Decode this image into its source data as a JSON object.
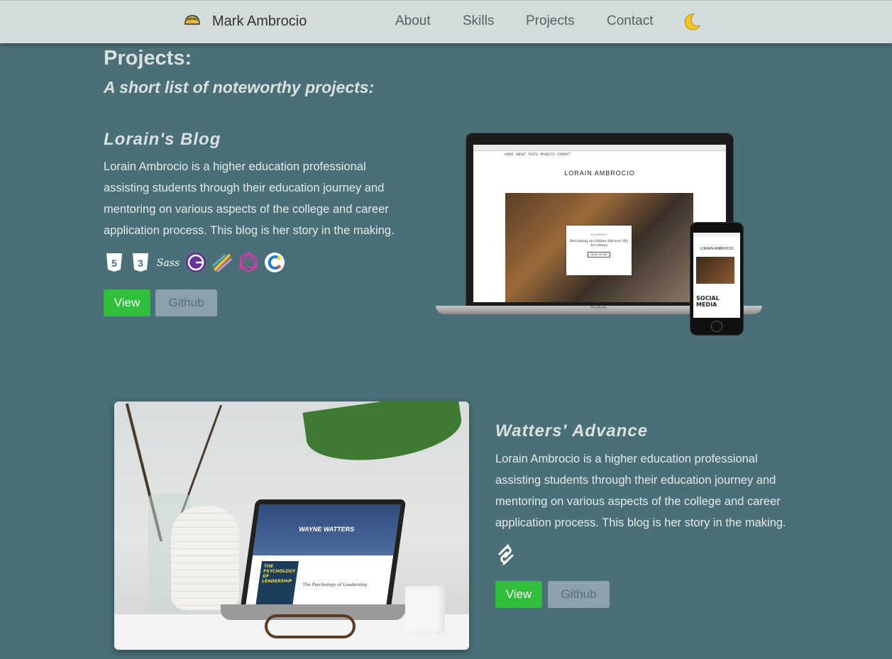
{
  "nav": {
    "brand": "Mark Ambrocio",
    "links": [
      "About",
      "Skills",
      "Projects",
      "Contact"
    ]
  },
  "page": {
    "title": "Projects:",
    "subtitle": "A short list of noteworthy projects:"
  },
  "projects": [
    {
      "title": "Lorain's Blog",
      "description": "Lorain Ambrocio is a higher education professional assisting students through their education journey and mentoring on various aspects of the college and career application process. This blog is her story in the making.",
      "tech_icons": [
        "html5-icon",
        "css3-icon",
        "sass-icon",
        "gatsby-icon",
        "prettier-icon",
        "graphql-icon",
        "contentful-icon"
      ],
      "view_label": "View",
      "github_label": "Github",
      "mockup": {
        "site_title": "LORAIN AMBROCIO",
        "nav_items": "HOME · ABOUT · POSTS · PROJECTS · CONTACT",
        "card_tag": "PLANNING",
        "card_title": "Becoming an Online Advisor (By Accident)",
        "card_button": "READ MORE",
        "laptop_label": "MacBook",
        "phone_title": "LORAIN AMBROCIO",
        "phone_banner": "SOCIAL MEDIA"
      }
    },
    {
      "title": "Watters' Advance",
      "description": "Lorain Ambrocio is a higher education professional assisting students through their education journey and mentoring on various aspects of the college and career application process. This blog is her story in the making.",
      "tech_icons": [
        "squarespace-icon"
      ],
      "view_label": "View",
      "github_label": "Github",
      "mockup": {
        "site_title": "WAYNE WATTERS",
        "book_title": "THE PSYCHOLOGY OF LEADERSHIP",
        "book_side": "The Psychology of Leadership"
      }
    }
  ],
  "colors": {
    "background": "#4a6f76",
    "nav": "#d3dcda",
    "view_button": "#2fbf3a",
    "github_button": "#8ba2aa"
  }
}
